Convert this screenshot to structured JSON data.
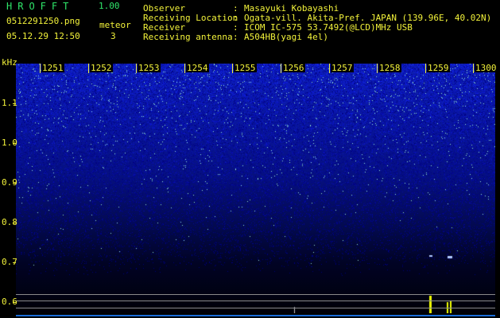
{
  "app": {
    "title": "HROFFT",
    "version": "1.00"
  },
  "file": {
    "name": "0512291250.png",
    "datetime": "05.12.29 12:50"
  },
  "meteor": {
    "label": "meteor",
    "count": "3"
  },
  "info": [
    {
      "key": "Observer",
      "value": "Masayuki Kobayashi"
    },
    {
      "key": "Receiving Location",
      "value": "Ogata-vill. Akita-Pref. JAPAN (139.96E, 40.02N)"
    },
    {
      "key": "Receiver",
      "value": "ICOM IC-575 53.7492(@LCD)MHz USB"
    },
    {
      "key": "Receiving antenna",
      "value": "A504HB(yagi 4el)"
    }
  ],
  "chart_data": {
    "type": "heatmap",
    "ylabel": "kHz",
    "y_ticks": [
      "1.1",
      "1.0",
      "0.9",
      "0.8",
      "0.7",
      "0.6"
    ],
    "x_ticks": [
      "1251",
      "1252",
      "1253",
      "1254",
      "1255",
      "1256",
      "1257",
      "1258",
      "1259",
      "1300"
    ],
    "colors": {
      "strong": "#1a3cff",
      "speck": "#c8ffe6",
      "echo": "#f0ff00",
      "baseline": "#1a6bd8",
      "axis": "#f2f23a"
    }
  }
}
